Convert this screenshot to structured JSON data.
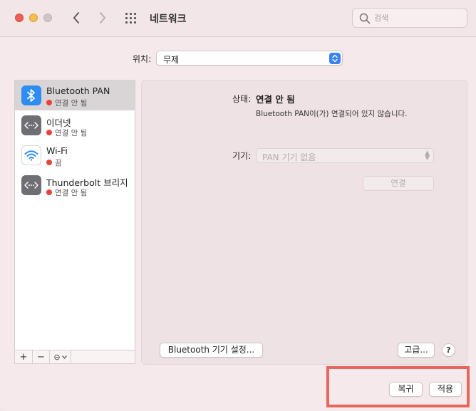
{
  "window": {
    "title": "네트워크"
  },
  "search": {
    "placeholder": "검색",
    "value": ""
  },
  "location": {
    "label": "위치:",
    "value": "무제"
  },
  "services": [
    {
      "name": "Bluetooth PAN",
      "status": "연결 안 됨",
      "status_color": "#e8423b",
      "icon": "bluetooth-icon",
      "selected": true
    },
    {
      "name": "이더넷",
      "status": "연결 안 됨",
      "status_color": "#e8423b",
      "icon": "ethernet-icon",
      "selected": false
    },
    {
      "name": "Wi-Fi",
      "status": "끔",
      "status_color": "#e8423b",
      "icon": "wifi-icon",
      "selected": false
    },
    {
      "name": "Thunderbolt 브리지",
      "status": "연결 안 됨",
      "status_color": "#e8423b",
      "icon": "thunderbolt-bridge-icon",
      "selected": false
    }
  ],
  "sidebar_tools": {
    "add": "+",
    "remove": "−",
    "action": "⊝"
  },
  "detail": {
    "status_label": "상태:",
    "status_value": "연결 안 됨",
    "description": "Bluetooth PAN이(가) 연결되어 있지 않습니다.",
    "device_label": "기기:",
    "device_value": "PAN 기기 없음",
    "connect_button": "연결",
    "bt_settings_button": "Bluetooth 기기 설정...",
    "advanced_button": "고급...",
    "help_button": "?"
  },
  "footer": {
    "revert_button": "복귀",
    "apply_button": "적용"
  },
  "colors": {
    "accent": "#3b82f6",
    "highlight": "#e8675d",
    "status_off": "#e8423b"
  }
}
